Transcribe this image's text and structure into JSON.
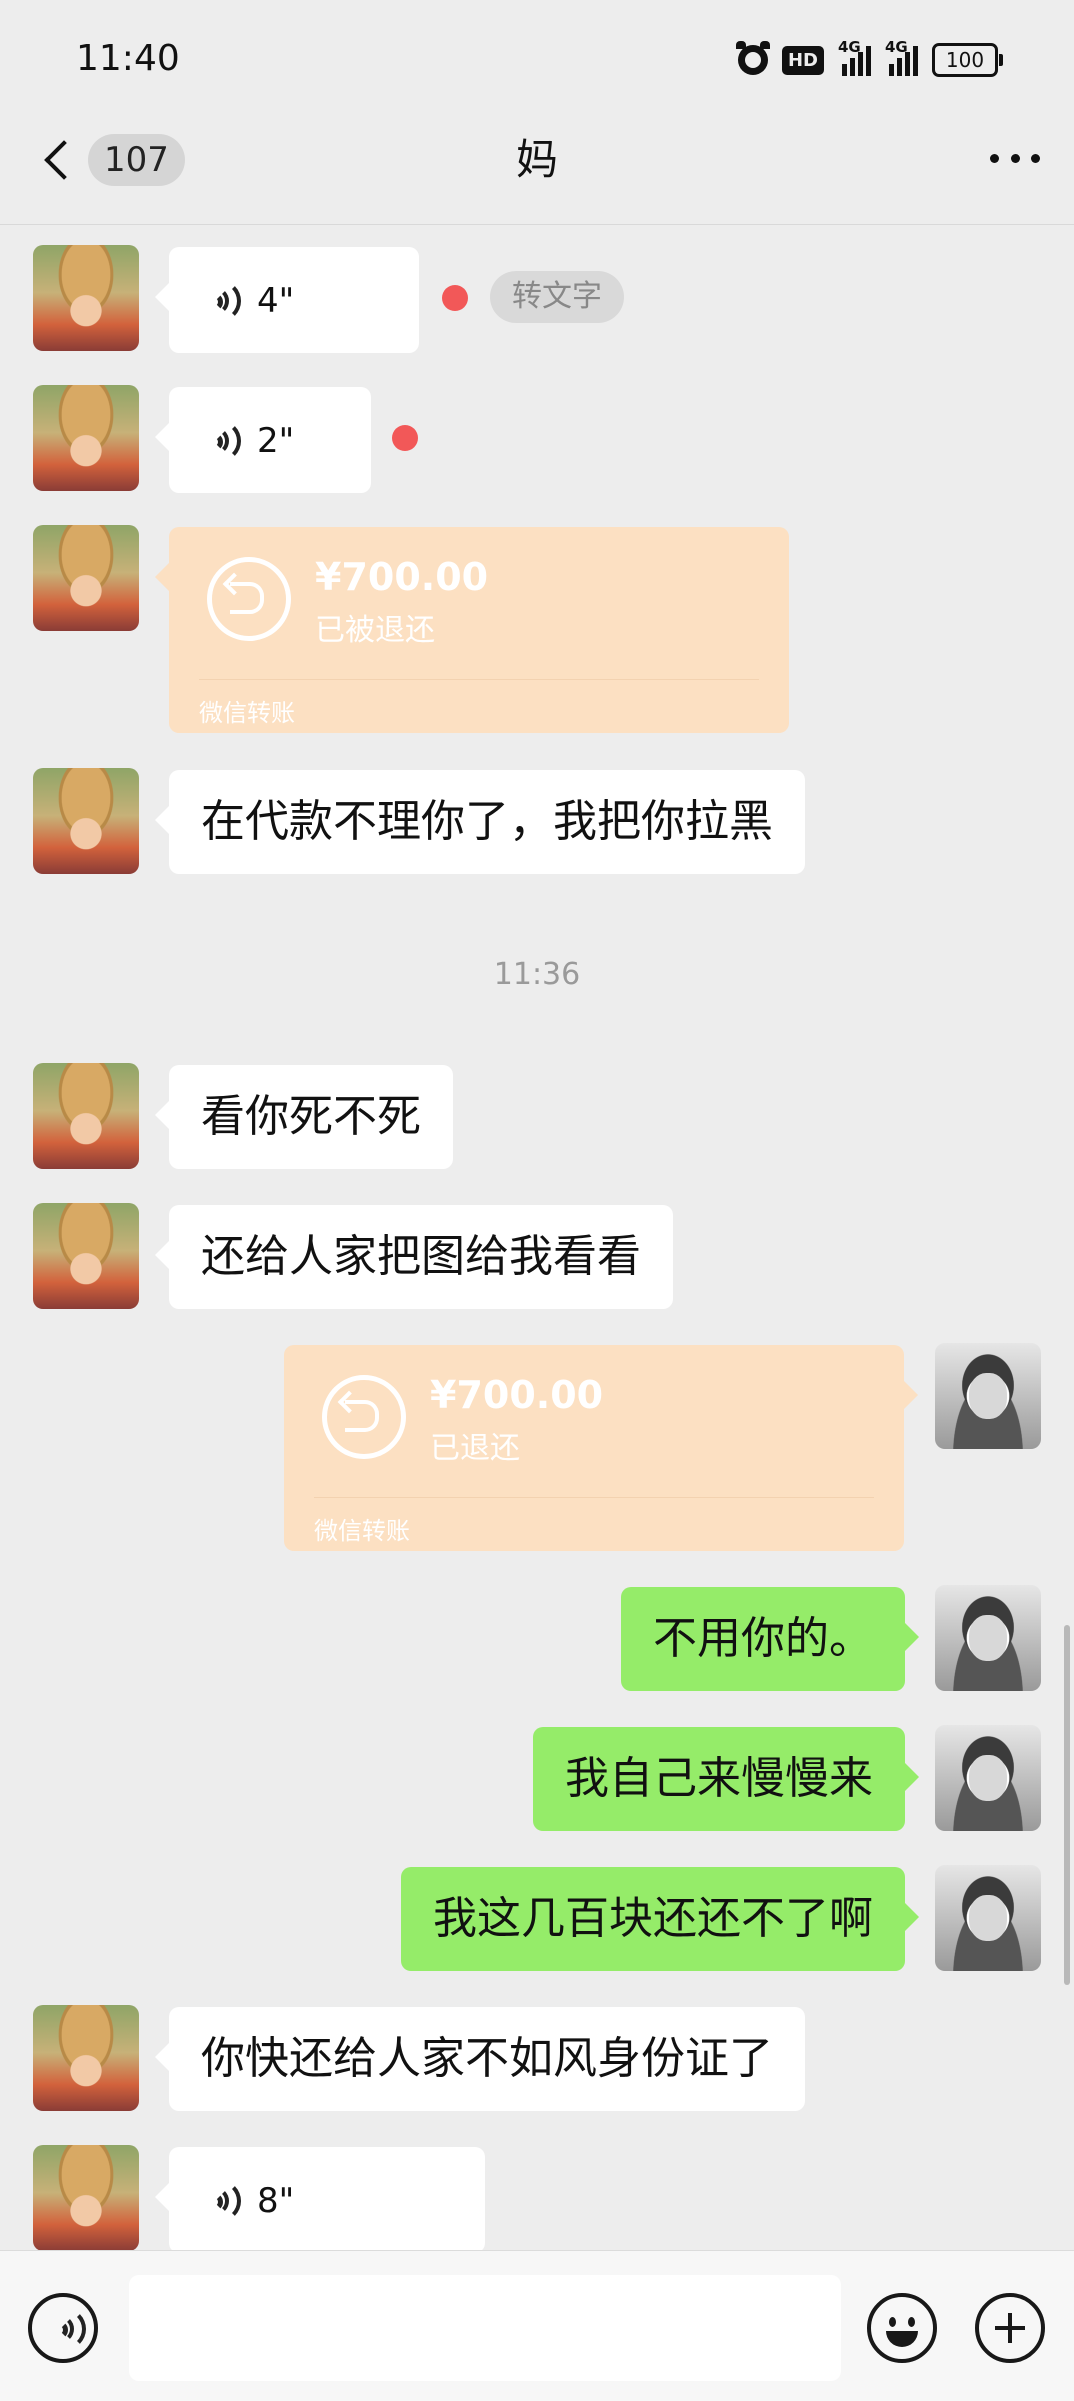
{
  "status_bar": {
    "time": "11:40",
    "hd_label": "HD",
    "net1": "4G",
    "net2": "4G",
    "battery": "100"
  },
  "header": {
    "unread_count": "107",
    "title": "妈"
  },
  "messages": {
    "voice1_duration": "4\"",
    "voice1_to_text": "转文字",
    "voice2_duration": "2\"",
    "transfer1_amount": "¥700.00",
    "transfer1_status": "已被退还",
    "transfer1_label": "微信转账",
    "text1": "在代款不理你了，我把你拉黑",
    "timestamp": "11:36",
    "text2": "看你死不死",
    "text3": "还给人家把图给我看看",
    "transfer2_amount": "¥700.00",
    "transfer2_status": "已退还",
    "transfer2_label": "微信转账",
    "sent1": "不用你的。",
    "sent2": "我自己来慢慢来",
    "sent3": "我这几百块还还不了啊",
    "text4": "你快还给人家不如风身份证了",
    "voice3_duration": "8\""
  },
  "input_bar": {
    "placeholder": ""
  },
  "colors": {
    "background": "#ededed",
    "sent_bubble": "#95ec69",
    "received_bubble": "#ffffff",
    "transfer_card": "#fce0c2",
    "unread_dot": "#f25858"
  }
}
